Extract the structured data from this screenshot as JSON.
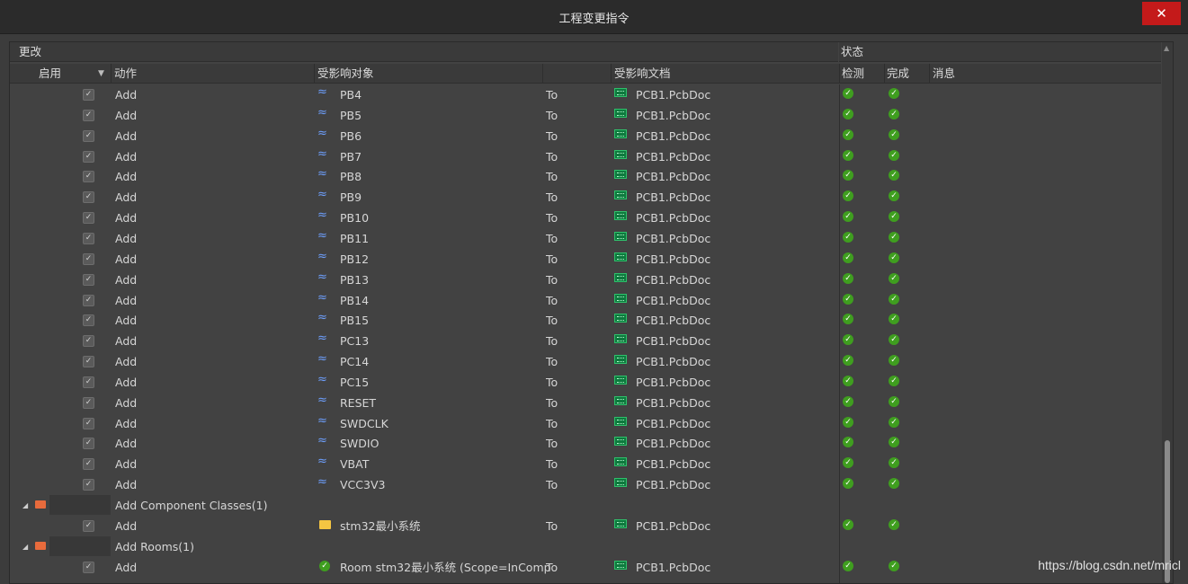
{
  "window": {
    "title": "工程变更指令",
    "close_label": "✕"
  },
  "headers": {
    "group_changes": "更改",
    "group_status": "状态",
    "enable": "启用",
    "action": "动作",
    "affected_object": "受影响对象",
    "affected_document": "受影响文档",
    "check": "检测",
    "done": "完成",
    "message": "消息"
  },
  "rows": [
    {
      "type": "item",
      "action": "Add",
      "object": "PB4",
      "icon": "net-icon",
      "to": "To",
      "doc": "PCB1.PcbDoc"
    },
    {
      "type": "item",
      "action": "Add",
      "object": "PB5",
      "icon": "net-icon",
      "to": "To",
      "doc": "PCB1.PcbDoc"
    },
    {
      "type": "item",
      "action": "Add",
      "object": "PB6",
      "icon": "net-icon",
      "to": "To",
      "doc": "PCB1.PcbDoc"
    },
    {
      "type": "item",
      "action": "Add",
      "object": "PB7",
      "icon": "net-icon",
      "to": "To",
      "doc": "PCB1.PcbDoc"
    },
    {
      "type": "item",
      "action": "Add",
      "object": "PB8",
      "icon": "net-icon",
      "to": "To",
      "doc": "PCB1.PcbDoc"
    },
    {
      "type": "item",
      "action": "Add",
      "object": "PB9",
      "icon": "net-icon",
      "to": "To",
      "doc": "PCB1.PcbDoc"
    },
    {
      "type": "item",
      "action": "Add",
      "object": "PB10",
      "icon": "net-icon",
      "to": "To",
      "doc": "PCB1.PcbDoc"
    },
    {
      "type": "item",
      "action": "Add",
      "object": "PB11",
      "icon": "net-icon",
      "to": "To",
      "doc": "PCB1.PcbDoc"
    },
    {
      "type": "item",
      "action": "Add",
      "object": "PB12",
      "icon": "net-icon",
      "to": "To",
      "doc": "PCB1.PcbDoc"
    },
    {
      "type": "item",
      "action": "Add",
      "object": "PB13",
      "icon": "net-icon",
      "to": "To",
      "doc": "PCB1.PcbDoc"
    },
    {
      "type": "item",
      "action": "Add",
      "object": "PB14",
      "icon": "net-icon",
      "to": "To",
      "doc": "PCB1.PcbDoc"
    },
    {
      "type": "item",
      "action": "Add",
      "object": "PB15",
      "icon": "net-icon",
      "to": "To",
      "doc": "PCB1.PcbDoc"
    },
    {
      "type": "item",
      "action": "Add",
      "object": "PC13",
      "icon": "net-icon",
      "to": "To",
      "doc": "PCB1.PcbDoc"
    },
    {
      "type": "item",
      "action": "Add",
      "object": "PC14",
      "icon": "net-icon",
      "to": "To",
      "doc": "PCB1.PcbDoc"
    },
    {
      "type": "item",
      "action": "Add",
      "object": "PC15",
      "icon": "net-icon",
      "to": "To",
      "doc": "PCB1.PcbDoc"
    },
    {
      "type": "item",
      "action": "Add",
      "object": "RESET",
      "icon": "net-icon",
      "to": "To",
      "doc": "PCB1.PcbDoc"
    },
    {
      "type": "item",
      "action": "Add",
      "object": "SWDCLK",
      "icon": "net-icon",
      "to": "To",
      "doc": "PCB1.PcbDoc"
    },
    {
      "type": "item",
      "action": "Add",
      "object": "SWDIO",
      "icon": "net-icon",
      "to": "To",
      "doc": "PCB1.PcbDoc"
    },
    {
      "type": "item",
      "action": "Add",
      "object": "VBAT",
      "icon": "net-icon",
      "to": "To",
      "doc": "PCB1.PcbDoc"
    },
    {
      "type": "item",
      "action": "Add",
      "object": "VCC3V3",
      "icon": "net-icon",
      "to": "To",
      "doc": "PCB1.PcbDoc"
    },
    {
      "type": "group",
      "label": "Add Component Classes(1)"
    },
    {
      "type": "item",
      "action": "Add",
      "object": "stm32最小系统",
      "icon": "folder-icon",
      "to": "To",
      "doc": "PCB1.PcbDoc"
    },
    {
      "type": "group",
      "label": "Add Rooms(1)"
    },
    {
      "type": "item",
      "action": "Add",
      "object": "Room stm32最小系统 (Scope=InComp",
      "icon": "room-check-icon",
      "to": "To",
      "doc": "PCB1.PcbDoc"
    }
  ],
  "watermark": "https://blog.csdn.net/mricl"
}
